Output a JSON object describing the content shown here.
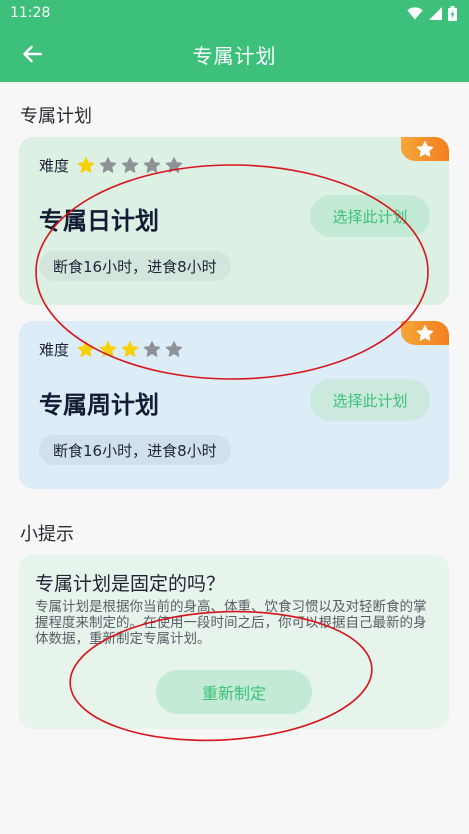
{
  "status_bar": {
    "time": "11:28"
  },
  "app_bar": {
    "title": "专属计划"
  },
  "section_plans": {
    "title": "专属计划"
  },
  "plans": [
    {
      "difficulty_label": "难度",
      "difficulty_stars": 1,
      "max_stars": 5,
      "name": "专属日计划",
      "choose_label": "选择此计划",
      "description": "断食16小时，进食8小时"
    },
    {
      "difficulty_label": "难度",
      "difficulty_stars": 3,
      "max_stars": 5,
      "name": "专属周计划",
      "choose_label": "选择此计划",
      "description": "断食16小时，进食8小时"
    }
  ],
  "section_tips": {
    "title": "小提示"
  },
  "tip": {
    "title": "专属计划是固定的吗？",
    "body": "专属计划是根据你当前的身高、体重、饮食习惯以及对轻断食的掌握程度来制定的。在使用一段时间之后，你可以根据自己最新的身体数据，重新制定专属计划。",
    "button_label": "重新制定"
  },
  "colors": {
    "brand": "#3cc07a",
    "star_on": "#f6d10a",
    "star_off": "#8e9296",
    "badge": "#f57f1e",
    "annotation": "#d8141c"
  }
}
